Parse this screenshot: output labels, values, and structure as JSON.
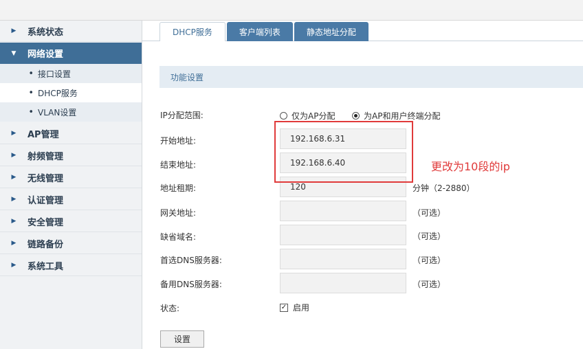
{
  "sidebar": {
    "items": [
      {
        "label": "系统状态",
        "arrow": "▶"
      },
      {
        "label": "网络设置",
        "arrow": "▼"
      },
      {
        "label": "AP管理",
        "arrow": "▶"
      },
      {
        "label": "射频管理",
        "arrow": "▶"
      },
      {
        "label": "无线管理",
        "arrow": "▶"
      },
      {
        "label": "认证管理",
        "arrow": "▶"
      },
      {
        "label": "安全管理",
        "arrow": "▶"
      },
      {
        "label": "链路备份",
        "arrow": "▶"
      },
      {
        "label": "系统工具",
        "arrow": "▶"
      }
    ],
    "subitems": [
      {
        "label": "接口设置",
        "bullet": "•"
      },
      {
        "label": "DHCP服务",
        "bullet": "•"
      },
      {
        "label": "VLAN设置",
        "bullet": "•"
      }
    ]
  },
  "tabs": [
    {
      "label": "DHCP服务"
    },
    {
      "label": "客户端列表"
    },
    {
      "label": "静态地址分配"
    }
  ],
  "section": {
    "title": "功能设置"
  },
  "form": {
    "ip_range": {
      "label": "IP分配范围:",
      "options": [
        "仅为AP分配",
        "为AP和用户终端分配"
      ],
      "selected": "为AP和用户终端分配"
    },
    "start": {
      "label": "开始地址:",
      "value": "192.168.6.31"
    },
    "end": {
      "label": "结束地址:",
      "value": "192.168.6.40"
    },
    "lease": {
      "label": "地址租期:",
      "value": "120",
      "hint": "分钟（2-2880）"
    },
    "gateway": {
      "label": "网关地址:",
      "value": "",
      "hint": "（可选）"
    },
    "domain": {
      "label": "缺省域名:",
      "value": "",
      "hint": "（可选）"
    },
    "dns1": {
      "label": "首选DNS服务器:",
      "value": "",
      "hint": "（可选）"
    },
    "dns2": {
      "label": "备用DNS服务器:",
      "value": "",
      "hint": "（可选）"
    },
    "status": {
      "label": "状态:",
      "checkbox_label": "启用",
      "checked": true,
      "check_glyph": "✓"
    },
    "save_label": "设置"
  },
  "annotation": {
    "text": "更改为10段的ip",
    "color": "#e03a3a"
  }
}
